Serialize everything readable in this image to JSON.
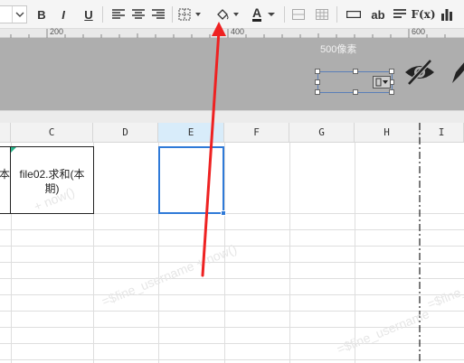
{
  "toolbar": {
    "bold": "B",
    "italic": "I",
    "underline": "U",
    "font_color_label": "A",
    "text_label": "ab",
    "formula_label": "F(x)"
  },
  "ruler": {
    "labels": [
      "200",
      "400",
      "600"
    ]
  },
  "canvas": {
    "size_label": "500像素"
  },
  "grid": {
    "columns": [
      "C",
      "D",
      "E",
      "F",
      "G",
      "H",
      "I"
    ],
    "selected_column": "E",
    "left_partial_text": "本",
    "cell_c_line1": "file02.求和(本",
    "cell_c_line2": "期)"
  },
  "watermark": {
    "text1": "=$fine_username + now()",
    "text2": "=$fine_username + now()",
    "text3": "=$fine_username",
    "text4": "+ now()"
  },
  "colors": {
    "selection_blue": "#2f7ad8",
    "arrow_red": "#ee2222",
    "header_selected": "#d8ecfa"
  }
}
